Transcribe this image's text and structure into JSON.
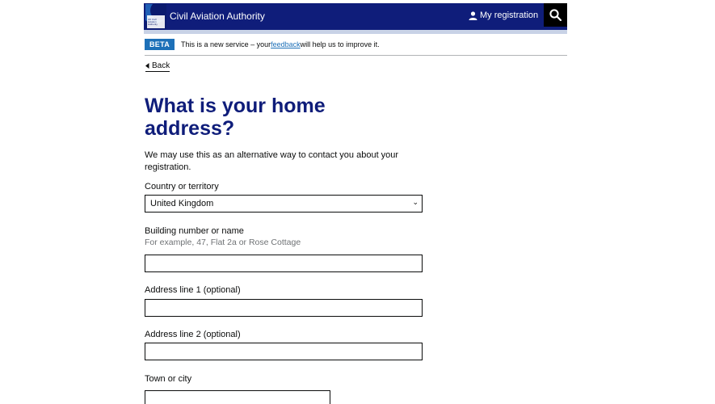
{
  "header": {
    "site_name": "Civil Aviation Authority",
    "logo_text": "UK Civil Aviation Authority",
    "my_registration": "My registration",
    "user_icon": "user-icon",
    "search_icon": "search-icon",
    "brand_color": "#0f1d7a"
  },
  "beta_banner": {
    "tag": "BETA",
    "text_before": "This is a new service – your ",
    "link": "feedback",
    "text_after": " will help us to improve it."
  },
  "back_link": "Back",
  "page": {
    "title": "What is your home address?",
    "intro": "We may use this as an alternative way to contact you about your registration."
  },
  "form": {
    "country": {
      "label": "Country or territory",
      "value": "United Kingdom"
    },
    "building": {
      "label": "Building number or name",
      "hint": "For example, 47, Flat 2a or Rose Cottage",
      "value": ""
    },
    "address1": {
      "label": "Address line 1 (optional)",
      "value": ""
    },
    "address2": {
      "label": "Address line 2 (optional)",
      "value": ""
    },
    "town": {
      "label": "Town or city",
      "value": ""
    }
  }
}
